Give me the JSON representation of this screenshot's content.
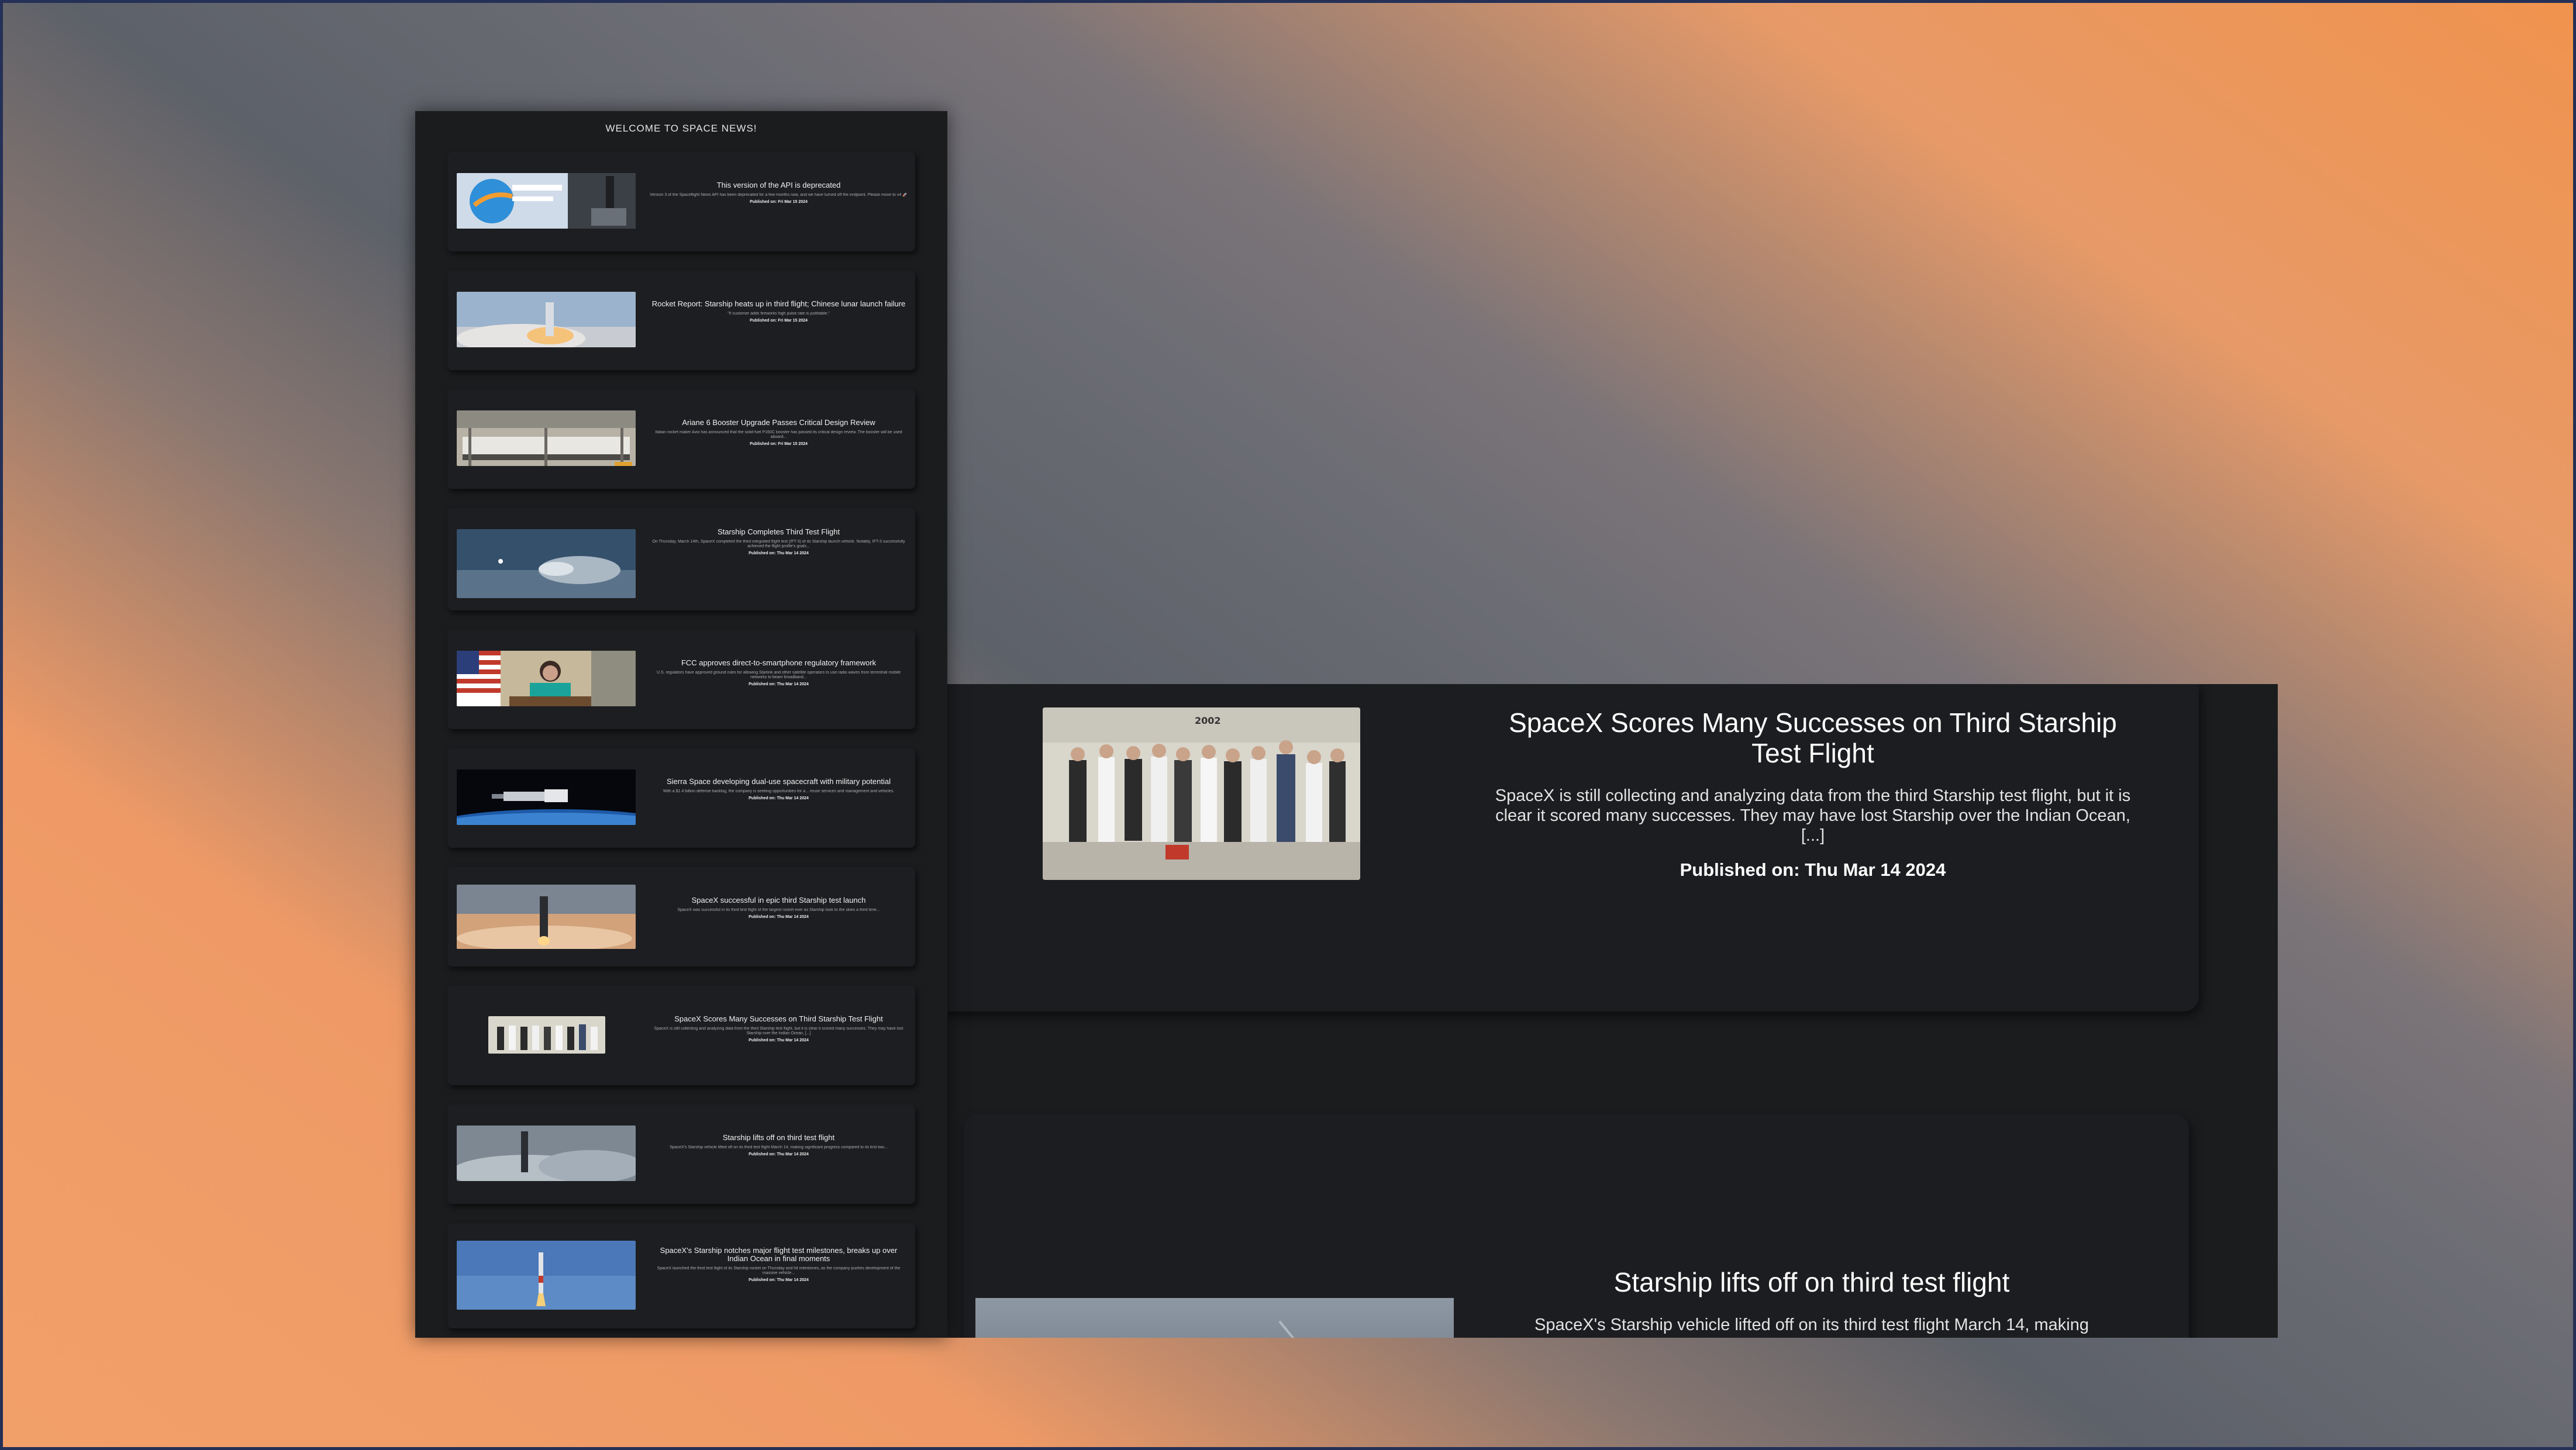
{
  "app": {
    "title": "WELCOME TO SPACE NEWS!"
  },
  "colors": {
    "panel": "#1b1c1e",
    "card": "#1d1e21",
    "text": "#f2f2f2",
    "frame": "#243056"
  },
  "news": [
    {
      "title": "This version of the API is deprecated",
      "summary": "Version 3 of the Spaceflight News API has been deprecated for a few months now, and we have turned off the endpoint. Please move to v4 🚀",
      "published": "Published on: Fri Mar 15 2024",
      "thumb": "api-deprecated-banner"
    },
    {
      "title": "Rocket Report: Starship heats up in third flight; Chinese lunar launch failure",
      "summary": "\"If customer adds fireworks high pulse rate is justifiable.\"",
      "published": "Published on: Fri Mar 15 2024",
      "thumb": "starship-launch-clouds"
    },
    {
      "title": "Ariane 6 Booster Upgrade Passes Critical Design Review",
      "summary": "Italian rocket maker Avio has announced that the solid-fuel P160C booster has passed its critical design review. The booster will be used aboard...",
      "published": "Published on: Fri Mar 15 2024",
      "thumb": "ariane-factory"
    },
    {
      "title": "Starship Completes Third Test Flight",
      "summary": "On Thursday, March 14th, SpaceX completed the third integrated flight test (IFT-3) of its Starship launch vehicle. Notably, IFT-3 successfully achieved the flight profile's goals...",
      "published": "Published on: Thu Mar 14 2024",
      "thumb": "starship-reentry"
    },
    {
      "title": "FCC approves direct-to-smartphone regulatory framework",
      "summary": "U.S. regulators have approved ground rules for allowing Starlink and other satellite operators to use radio waves from terrestrial mobile networks to beam broadband...",
      "published": "Published on: Thu Mar 14 2024",
      "thumb": "fcc-chair-flag"
    },
    {
      "title": "Sierra Space developing dual-use spacecraft with military potential",
      "summary": "With a $1.4 billion defense backlog, the company is seeking opportunities for a... reuse services and management and vehicles.",
      "published": "Published on: Thu Mar 14 2024",
      "thumb": "sierra-spacecraft-earth"
    },
    {
      "title": "SpaceX successful in epic third Starship test launch",
      "summary": "SpaceX was successful in its third test flight of the largest rocket ever as Starship took to the skies a third time...",
      "published": "Published on: Thu Mar 14 2024",
      "thumb": "starship-sunset-launch"
    },
    {
      "title": "SpaceX Scores Many Successes on Third Starship Test Flight",
      "summary": "SpaceX is still collecting and analyzing data from the third Starship test flight, but it is clear it scored many successes. They may have lost Starship over the Indian Ocean, [...]",
      "published": "Published on: Thu Mar 14 2024",
      "thumb": "spacex-team-photo"
    },
    {
      "title": "Starship lifts off on third test flight",
      "summary": "SpaceX's Starship vehicle lifted off on its third test flight March 14, making significant progress compared to its first two...",
      "published": "Published on: Thu Mar 14 2024",
      "thumb": "starship-fog-liftoff"
    },
    {
      "title": "SpaceX's Starship notches major flight test milestones, breaks up over Indian Ocean in final moments",
      "summary": "SpaceX launched the third test flight of its Starship rocket on Thursday and hit milestones, as the company pushes development of the massive vehicle...",
      "published": "Published on: Thu Mar 14 2024",
      "thumb": "starship-blue-sky"
    }
  ],
  "detail": {
    "first": {
      "title": "SpaceX Scores Many Successes on Third Starship Test Flight",
      "summary": "SpaceX is still collecting and analyzing data from the third Starship test flight, but it is clear it scored many successes. They may have lost Starship over the Indian Ocean, [...]",
      "published": "Published on: Thu Mar 14 2024",
      "photo_caption": "2002"
    },
    "second": {
      "title": "Starship lifts off on third test flight",
      "summary": "SpaceX's Starship vehicle lifted off on its third test flight March 14, making"
    }
  }
}
